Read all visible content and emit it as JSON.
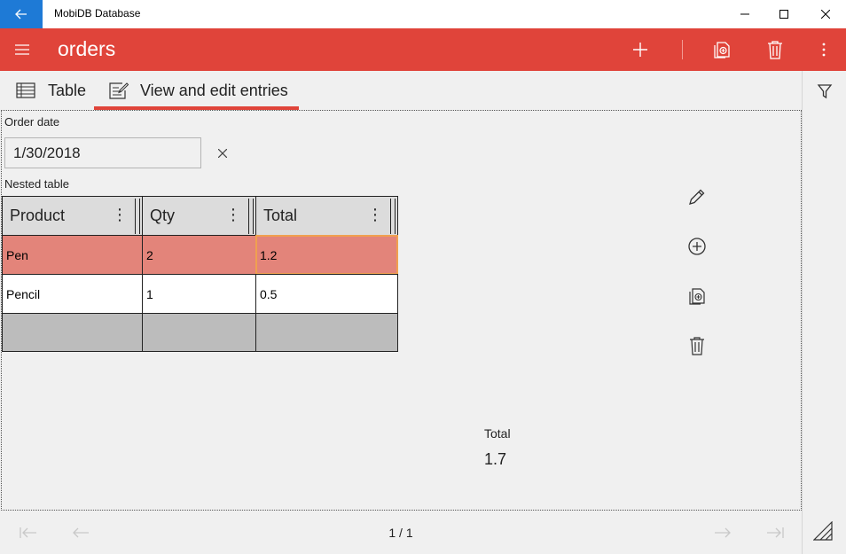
{
  "window": {
    "title": "MobiDB Database"
  },
  "header": {
    "title": "orders"
  },
  "tabs": [
    {
      "label": "Table"
    },
    {
      "label": "View and edit entries"
    }
  ],
  "form": {
    "order_date_label": "Order date",
    "order_date_value": "1/30/2018",
    "nested_table_label": "Nested table"
  },
  "nested_table": {
    "columns": [
      "Product",
      "Qty",
      "Total"
    ],
    "rows": [
      [
        "Pen",
        "2",
        "1.2"
      ],
      [
        "Pencil",
        "1",
        "0.5"
      ],
      [
        "",
        "",
        ""
      ]
    ]
  },
  "summary": {
    "total_label": "Total",
    "total_value": "1.7"
  },
  "pagination": {
    "indicator": "1 / 1"
  },
  "colors": {
    "accent": "#e0443a",
    "titlebar_back": "#1e7ad6",
    "selected_row": "#e3847a",
    "empty_row": "#bcbcbc"
  },
  "icons": {
    "back": "arrow-left-icon",
    "menu": "hamburger-icon",
    "add": "plus-icon",
    "duplicate": "duplicate-icon",
    "delete": "trash-icon",
    "more": "more-vertical-icon",
    "filter": "filter-icon",
    "table": "table-icon",
    "edit_entries": "edit-form-icon",
    "edit": "pencil-icon",
    "add_row": "add-circle-icon",
    "clear": "close-icon"
  }
}
